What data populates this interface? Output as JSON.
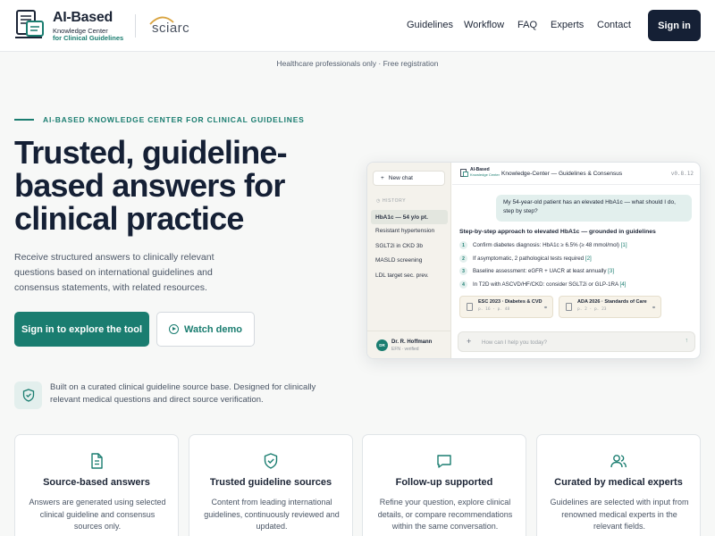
{
  "header": {
    "brand_title": "AI-Based",
    "brand_sub1": "Knowledge Center",
    "brand_sub2": "for Clinical Guidelines",
    "partner": "sciarc",
    "nav": [
      "Guidelines",
      "Workflow",
      "FAQ",
      "Experts",
      "Contact"
    ],
    "signin": "Sign in"
  },
  "notice": "Healthcare professionals only · Free registration",
  "hero": {
    "eyebrow": "AI-BASED KNOWLEDGE CENTER FOR CLINICAL GUIDELINES",
    "title": "Trusted, guideline-based answers for clinical practice",
    "description": "Receive structured answers to clinically relevant questions based on international guidelines and consensus statements, with related resources.",
    "primary_cta": "Sign in to explore the tool",
    "secondary_cta": "Watch demo",
    "trust_text": "Built on a curated clinical guideline source base. Designed for clinically relevant medical questions and direct source verification."
  },
  "preview": {
    "new_chat": "New chat",
    "history_label": "HISTORY",
    "history": [
      "HbA1c — 54 y/o pt.",
      "Resistant hypertension",
      "SGLT2i in CKD 3b",
      "MASLD screening",
      "LDL target sec. prev."
    ],
    "user_initials": "DR",
    "user_name": "Dr. R. Hoffmann",
    "user_sub": "EFN · verified",
    "mini_brand": "AI-Based",
    "mini_brand_sub": "Knowledge Center",
    "title": "Knowledge-Center — Guidelines & Consensus",
    "version": "v0.8.12",
    "user_message": "My 54-year-old patient has an elevated HbA1c — what should I do, step by step?",
    "answer_title": "Step-by-step approach to elevated HbA1c — grounded in guidelines",
    "steps": [
      {
        "n": "1",
        "text": "Confirm diabetes diagnosis: HbA1c ≥ 6.5% (≥ 48 mmol/mol)",
        "ref": "[1]"
      },
      {
        "n": "2",
        "text": "If asymptomatic, 2 pathological tests required",
        "ref": "[2]"
      },
      {
        "n": "3",
        "text": "Baseline assessment: eGFR + UACR at least annually",
        "ref": "[3]"
      },
      {
        "n": "4",
        "text": "In T2D with ASCVD/HF/CKD: consider SGLT2i or GLP-1RA",
        "ref": "[4]"
      }
    ],
    "sources": [
      {
        "title": "ESC 2023 · Diabetes & CVD",
        "sub": "p. 16 · p. 48"
      },
      {
        "title": "ADA 2026 · Standards of Care",
        "sub": "p. 2 · p. 23"
      }
    ],
    "input_placeholder": "How can I help you today?"
  },
  "features": [
    {
      "icon": "document-icon",
      "title": "Source-based answers",
      "text": "Answers are generated using selected clinical guideline and consensus sources only."
    },
    {
      "icon": "shield-check-icon",
      "title": "Trusted guideline sources",
      "text": "Content from leading international guidelines, continuously reviewed and updated."
    },
    {
      "icon": "chat-icon",
      "title": "Follow-up supported",
      "text": "Refine your question, explore clinical details, or compare recommendations within the same conversation."
    },
    {
      "icon": "users-icon",
      "title": "Curated by medical experts",
      "text": "Guidelines are selected with input from renowned medical experts in the relevant fields."
    }
  ],
  "colors": {
    "accent": "#1a7d70",
    "dark": "#152035"
  }
}
